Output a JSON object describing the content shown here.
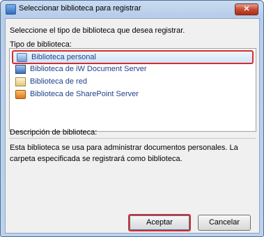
{
  "window": {
    "title": "Seleccionar biblioteca para registrar",
    "close_label": "✕"
  },
  "intro_text": "Seleccione el tipo de biblioteca que desea registrar.",
  "list_label": "Tipo de biblioteca:",
  "library_types": [
    {
      "label": "Biblioteca personal",
      "icon": "personal-library-icon",
      "selected": true
    },
    {
      "label": "Biblioteca de iW Document Server",
      "icon": "iw-server-icon",
      "selected": false
    },
    {
      "label": "Biblioteca de red",
      "icon": "network-library-icon",
      "selected": false
    },
    {
      "label": "Biblioteca de SharePoint Server",
      "icon": "sharepoint-icon",
      "selected": false
    }
  ],
  "description": {
    "label": "Descripción de biblioteca:",
    "text": "Esta biblioteca se usa para administrar documentos personales. La carpeta especificada se registrará como biblioteca."
  },
  "buttons": {
    "accept": "Aceptar",
    "cancel": "Cancelar"
  }
}
